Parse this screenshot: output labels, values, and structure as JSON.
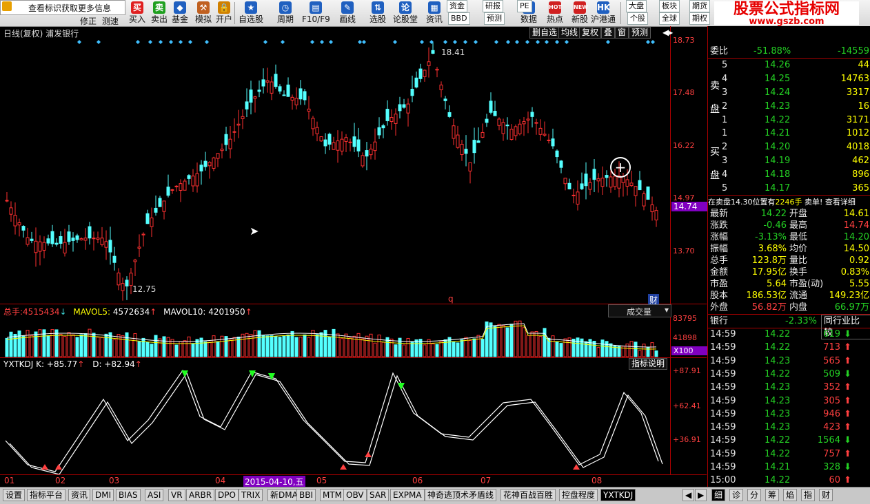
{
  "toolbar": {
    "tooltip_text": "查看标识获取更多信息",
    "tools_left": [
      "修正",
      "测速"
    ],
    "buttons": [
      {
        "label": "买入",
        "icon": "buy-icon",
        "glyph": "买",
        "color": "#e02020"
      },
      {
        "label": "卖出",
        "icon": "sell-icon",
        "glyph": "卖",
        "color": "#20a020"
      },
      {
        "label": "基金",
        "icon": "fund-icon",
        "glyph": "◆",
        "color": "#2060c0"
      },
      {
        "label": "模拟",
        "icon": "gavel-icon",
        "glyph": "⚒",
        "color": "#c06020"
      },
      {
        "label": "开户",
        "icon": "lock-icon",
        "glyph": "🔒",
        "color": "#d08000"
      },
      {
        "label": "自选股",
        "icon": "star-icon",
        "glyph": "★",
        "color": "#2060c0"
      },
      {
        "label": "周期",
        "icon": "clock-icon",
        "glyph": "◷",
        "color": "#2060c0"
      },
      {
        "label": "F10/F9",
        "icon": "chart-icon",
        "glyph": "▤",
        "color": "#2060c0"
      },
      {
        "label": "画线",
        "icon": "pen-icon",
        "glyph": "✎",
        "color": "#2060c0"
      },
      {
        "label": "选股",
        "icon": "arrows-icon",
        "glyph": "⇅",
        "color": "#2060c0"
      },
      {
        "label": "论股堂",
        "icon": "forum-icon",
        "glyph": "论",
        "color": "#2060c0"
      },
      {
        "label": "资讯",
        "icon": "news-icon",
        "glyph": "▦",
        "color": "#2060c0"
      }
    ],
    "mini_buttons": [
      "资金",
      "BBD",
      "研报",
      "预测",
      "PE",
      "大盘",
      "个股",
      "板块",
      "全球",
      "期货",
      "期权"
    ],
    "buttons_right": [
      {
        "label": "数据",
        "icon": "data-icon",
        "glyph": "▥",
        "color": "#2060c0"
      },
      {
        "label": "热点",
        "icon": "hot-icon",
        "glyph": "HOT",
        "color": "#d02020"
      },
      {
        "label": "新股",
        "icon": "newstock-icon",
        "glyph": "NEW",
        "color": "#d02020"
      },
      {
        "label": "沪港通",
        "icon": "shhk-icon",
        "glyph": "HK",
        "color": "#2060c0"
      }
    ],
    "brand_title": "股票公式指标网",
    "brand_url": "www.gszb.com"
  },
  "chart_header": {
    "title": "日线(复权) 浦发银行",
    "buttons": [
      "删自选",
      "均线",
      "复权",
      "叠",
      "窗",
      "预测"
    ]
  },
  "price_axis": [
    "18.73",
    "17.48",
    "16.22",
    "14.97",
    "13.70"
  ],
  "current_price": "14.74",
  "annotations": {
    "high": "18.41",
    "low": "12.75",
    "q_marker": "q",
    "cai_marker": "财"
  },
  "volume_pane": {
    "total_label": "总手:",
    "total_value": "4515434",
    "mavol5_label": "MAVOL5:",
    "mavol5_value": "4572634",
    "mavol10_label": "MAVOL10:",
    "mavol10_value": "4201950",
    "dropdown": "成交量",
    "axis": [
      "83795",
      "41898"
    ],
    "unit": "X100"
  },
  "kdj_pane": {
    "name": "YXTKDJ",
    "k_label": "K:",
    "k_value": "+85.77",
    "d_label": "D:",
    "d_value": "+82.94",
    "help_button": "指标说明",
    "axis": [
      "+87.91",
      "+62.41",
      "+36.91"
    ]
  },
  "date_axis": [
    "01",
    "02",
    "03",
    "04",
    "05",
    "06",
    "07",
    "08"
  ],
  "cursor_date": "2015-04-10,五",
  "right_panel": {
    "weibi_label": "委比",
    "weibi_value": "-51.88%",
    "weicha_value": "-14559",
    "sell_label": [
      "卖",
      "盘"
    ],
    "asks": [
      {
        "level": "5",
        "price": "14.26",
        "vol": "44"
      },
      {
        "level": "4",
        "price": "14.25",
        "vol": "14763"
      },
      {
        "level": "3",
        "price": "14.24",
        "vol": "3317"
      },
      {
        "level": "2",
        "price": "14.23",
        "vol": "16"
      },
      {
        "level": "1",
        "price": "14.22",
        "vol": "3171"
      }
    ],
    "buy_label": [
      "买",
      "盘"
    ],
    "bids": [
      {
        "level": "1",
        "price": "14.21",
        "vol": "1012"
      },
      {
        "level": "2",
        "price": "14.20",
        "vol": "4018"
      },
      {
        "level": "3",
        "price": "14.19",
        "vol": "462"
      },
      {
        "level": "4",
        "price": "14.18",
        "vol": "896"
      },
      {
        "level": "5",
        "price": "14.17",
        "vol": "365"
      }
    ],
    "sell_note_prefix": "在卖盘14.30位置有",
    "sell_note_qty": "2246手",
    "sell_note_suffix": "卖单!",
    "detail_link": "查看详细",
    "stats": [
      {
        "l": "最新",
        "v": "14.22",
        "l2": "开盘",
        "v2": "14.61"
      },
      {
        "l": "涨跌",
        "v": "-0.46",
        "l2": "最高",
        "v2": "14.74"
      },
      {
        "l": "涨幅",
        "v": "-3.13%",
        "l2": "最低",
        "v2": "14.20"
      },
      {
        "l": "振幅",
        "v": "3.68%",
        "l2": "均价",
        "v2": "14.50"
      },
      {
        "l": "总手",
        "v": "123.8万",
        "l2": "量比",
        "v2": "0.92"
      },
      {
        "l": "金额",
        "v": "17.95亿",
        "l2": "换手",
        "v2": "0.83%"
      },
      {
        "l": "市盈",
        "v": "5.64",
        "l2": "市盈(动)",
        "v2": "5.55"
      },
      {
        "l": "股本",
        "v": "186.53亿",
        "l2": "流通",
        "v2": "149.23亿"
      },
      {
        "l": "外盘",
        "v": "56.82万",
        "l2": "内盘",
        "v2": "66.97万"
      }
    ],
    "industry_label": "银行",
    "industry_change": "-2.33%",
    "industry_button": "同行业比较",
    "ticks": [
      {
        "t": "14:59",
        "p": "14.22",
        "v": "619",
        "d": "down"
      },
      {
        "t": "14:59",
        "p": "14.22",
        "v": "713",
        "d": "up"
      },
      {
        "t": "14:59",
        "p": "14.23",
        "v": "565",
        "d": "up"
      },
      {
        "t": "14:59",
        "p": "14.22",
        "v": "509",
        "d": "down"
      },
      {
        "t": "14:59",
        "p": "14.23",
        "v": "352",
        "d": "up"
      },
      {
        "t": "14:59",
        "p": "14.23",
        "v": "305",
        "d": "up"
      },
      {
        "t": "14:59",
        "p": "14.23",
        "v": "946",
        "d": "up"
      },
      {
        "t": "14:59",
        "p": "14.23",
        "v": "423",
        "d": "up"
      },
      {
        "t": "14:59",
        "p": "14.22",
        "v": "1564",
        "d": "down"
      },
      {
        "t": "14:59",
        "p": "14.22",
        "v": "757",
        "d": "up"
      },
      {
        "t": "14:59",
        "p": "14.21",
        "v": "328",
        "d": "down"
      },
      {
        "t": "15:00",
        "p": "14.22",
        "v": "60",
        "d": "up"
      }
    ]
  },
  "bottom_tabs": [
    "设置",
    "指标平台",
    "资讯",
    "DMI",
    "BIAS",
    "ASI",
    "VR",
    "ARBR",
    "DPO",
    "TRIX",
    "新DMA",
    "BBI",
    "MTM",
    "OBV",
    "SAR",
    "EXPMA",
    "神奇逃顶术矛盾线",
    "花神百战百胜",
    "控盘程度",
    "YXTKDJ"
  ],
  "active_tab": "YXTKDJ",
  "right_tabs": [
    "细",
    "诊",
    "分",
    "筹",
    "焰",
    "指",
    "财"
  ]
}
